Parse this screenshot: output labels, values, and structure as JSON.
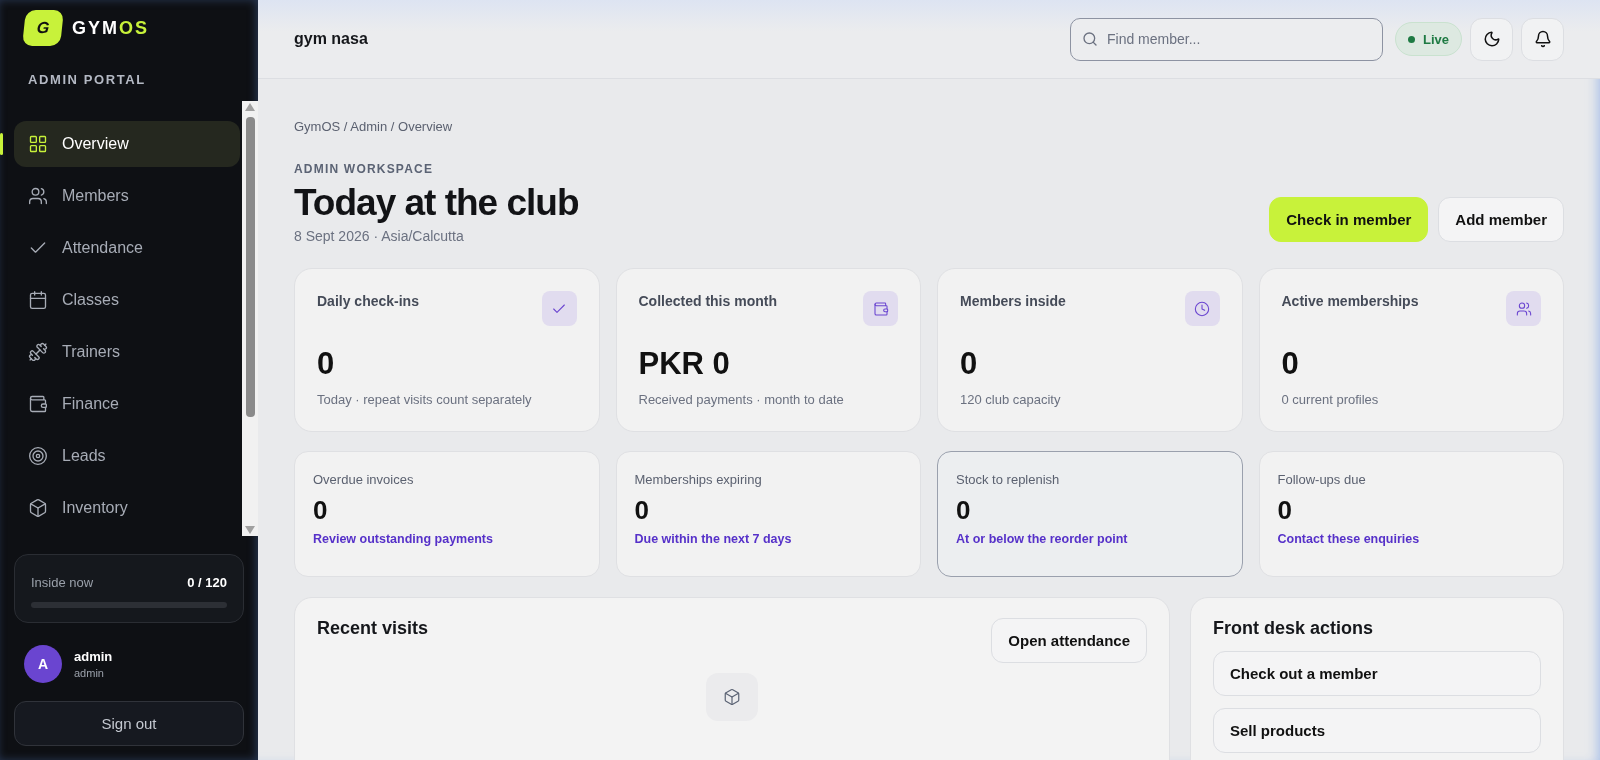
{
  "brand": {
    "logo_letter": "G",
    "name_main": "GYM",
    "name_accent": "OS"
  },
  "sidebar": {
    "section": "ADMIN PORTAL",
    "items": [
      {
        "label": "Overview",
        "selected": true
      },
      {
        "label": "Members",
        "selected": false
      },
      {
        "label": "Attendance",
        "selected": false
      },
      {
        "label": "Classes",
        "selected": false
      },
      {
        "label": "Trainers",
        "selected": false
      },
      {
        "label": "Finance",
        "selected": false
      },
      {
        "label": "Leads",
        "selected": false
      },
      {
        "label": "Inventory",
        "selected": false
      }
    ]
  },
  "occupancy": {
    "label": "Inside now",
    "reading": "0 / 120",
    "level": 0
  },
  "user": {
    "initial": "A",
    "name": "admin",
    "role": "admin"
  },
  "sign_out": "Sign out",
  "header": {
    "title": "gym nasa",
    "search": {
      "placeholder": "Find member..."
    },
    "status": "Live"
  },
  "breadcrumb": "GymOS / Admin / Overview",
  "eyebrow": "ADMIN WORKSPACE",
  "title": "Today at the club",
  "subtitle": "8 Sept 2026 · Asia/Calcutta",
  "actions": [
    {
      "label": "Check in member",
      "kind": "primary"
    },
    {
      "label": "Add member",
      "kind": "secondary"
    }
  ],
  "stats": [
    {
      "title": "Daily check-ins",
      "value": "0",
      "note": "Today · repeat visits count separately"
    },
    {
      "title": "Collected this month",
      "value": "PKR 0",
      "note": "Received payments · month to date"
    },
    {
      "title": "Members inside",
      "value": "0",
      "note": "120 club capacity"
    },
    {
      "title": "Active memberships",
      "value": "0",
      "note": "0 current profiles"
    }
  ],
  "alerts": [
    {
      "title": "Overdue invoices",
      "value": "0",
      "link": "Review outstanding payments",
      "selected": false
    },
    {
      "title": "Memberships expiring",
      "value": "0",
      "link": "Due within the next 7 days",
      "selected": false
    },
    {
      "title": "Stock to replenish",
      "value": "0",
      "link": "At or below the reorder point",
      "selected": true
    },
    {
      "title": "Follow-ups due",
      "value": "0",
      "link": "Contact these enquiries",
      "selected": false
    }
  ],
  "recent_visits": {
    "title": "Recent visits",
    "button": "Open attendance"
  },
  "front_desk": {
    "title": "Front desk actions",
    "actions": [
      "Check out a member",
      "Sell products"
    ]
  }
}
